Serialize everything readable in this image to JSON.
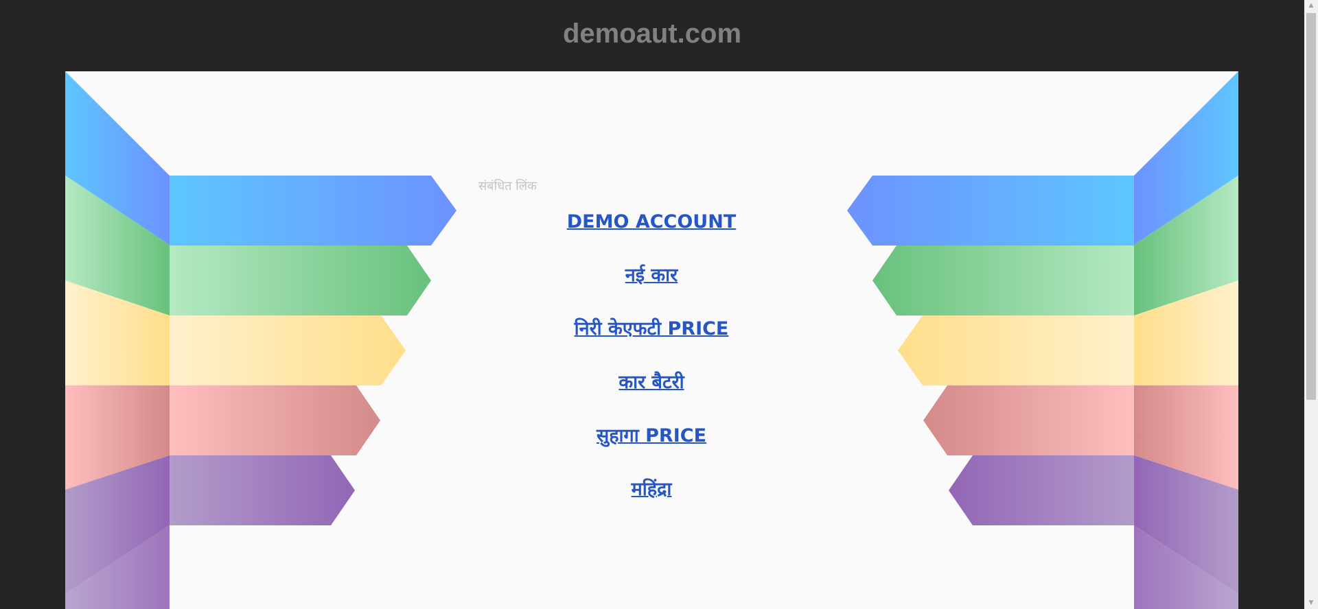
{
  "header": {
    "domain": "demoaut.com"
  },
  "main": {
    "related_label": "संबंधित लिंक",
    "links": [
      {
        "label": "DEMO ACCOUNT"
      },
      {
        "label": "नई कार"
      },
      {
        "label": "निरी केएफटी PRICE"
      },
      {
        "label": "कार बैटरी"
      },
      {
        "label": "सुहागा PRICE"
      },
      {
        "label": "महिंद्रा"
      }
    ]
  },
  "colors": {
    "page_bg": "#252525",
    "panel_bg": "#fafafa",
    "link": "#2456c8",
    "blue": [
      "#5ec6ff",
      "#6495ff"
    ],
    "green": [
      "#b4e8c1",
      "#6ac27f"
    ],
    "yellow": [
      "#fff0c9",
      "#ffdf8e"
    ],
    "red": [
      "#ffbcbc",
      "#d48b8b"
    ],
    "purple": [
      "#b19ac9",
      "#9267b5"
    ]
  }
}
